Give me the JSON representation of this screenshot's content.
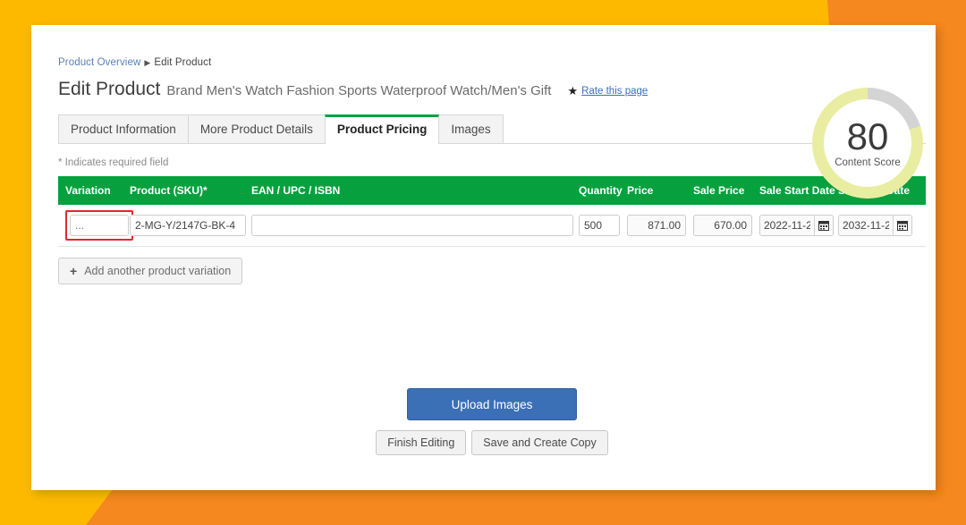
{
  "breadcrumb": {
    "parent": "Product Overview",
    "separator": "▶",
    "current": "Edit Product"
  },
  "header": {
    "title": "Edit Product",
    "product_name": "Brand Men's Watch Fashion Sports Waterproof Watch/Men's Gift",
    "star_icon": "star-icon",
    "rate_link": "Rate this page"
  },
  "tabs": [
    {
      "label": "Product Information",
      "active": false
    },
    {
      "label": "More Product Details",
      "active": false
    },
    {
      "label": "Product Pricing",
      "active": true
    },
    {
      "label": "Images",
      "active": false
    }
  ],
  "content_score": {
    "value": "80",
    "label": "Content Score",
    "percent": 80,
    "fill_color": "#e9eda2",
    "track_color": "#d4d4d4"
  },
  "required_note": "* Indicates required field",
  "pricing_table": {
    "header_color": "#06a13e",
    "columns": [
      "Variation",
      "Product (SKU)*",
      "EAN / UPC / ISBN",
      "Quantity",
      "Price",
      "Sale Price",
      "Sale Start Date",
      "Sale End Date"
    ],
    "rows": [
      {
        "variation": "",
        "variation_placeholder": "...",
        "variation_highlighted": true,
        "highlight_color": "#e8262b",
        "sku": "2-MG-Y/2147G-BK-4",
        "ean": "",
        "quantity": "500",
        "price": "871.00",
        "sale_price": "670.00",
        "sale_start_date": "2022-11-2",
        "sale_end_date": "2032-11-2",
        "calendar_icon": "calendar-icon"
      }
    ]
  },
  "add_variation": {
    "plus_icon": "plus-icon",
    "label": "Add another product variation"
  },
  "actions": {
    "upload_label": "Upload Images",
    "upload_color": "#3b6fb6",
    "finish_label": "Finish Editing",
    "copy_label": "Save and Create Copy"
  },
  "background": {
    "yellow": "#fcb900",
    "orange": "#f5881f"
  }
}
